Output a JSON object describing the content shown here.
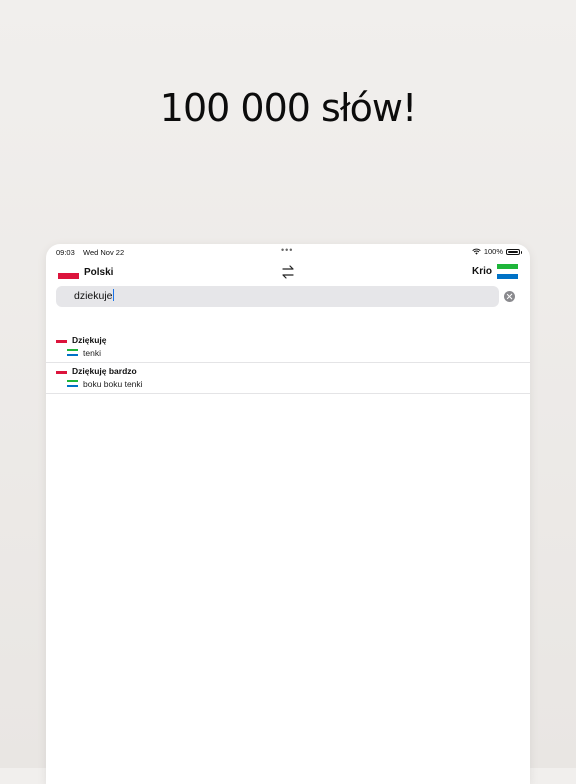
{
  "headline": "100 000 słów!",
  "status": {
    "time": "09:03",
    "date": "Wed Nov 22",
    "dots": "•••",
    "battery": "100%"
  },
  "languages": {
    "source": "Polski",
    "target": "Krio"
  },
  "search": {
    "value": "dziekuje"
  },
  "results": [
    {
      "term": "Dziękuję",
      "translation": "tenki"
    },
    {
      "term": "Dziękuję bardzo",
      "translation": "boku boku tenki"
    }
  ],
  "colors": {
    "pl_red": "#dc143c",
    "sl_green": "#1eb53a",
    "sl_blue": "#0072c6",
    "caret": "#1a73e8"
  }
}
